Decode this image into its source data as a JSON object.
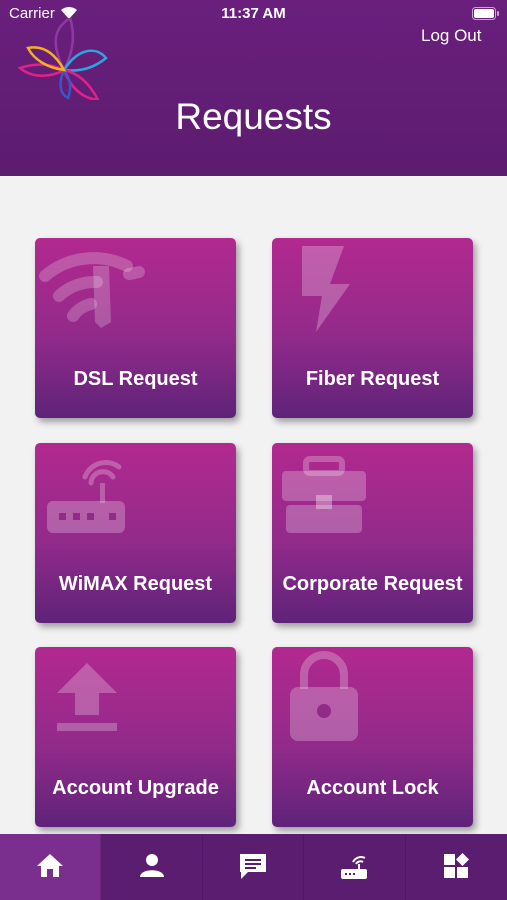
{
  "status_bar": {
    "carrier": "Carrier",
    "time": "11:37 AM"
  },
  "header": {
    "title": "Requests",
    "logout_label": "Log Out"
  },
  "tiles": [
    {
      "label": "DSL Request",
      "icon": "wifi-gauge-icon"
    },
    {
      "label": "Fiber Request",
      "icon": "lightning-bolt-icon"
    },
    {
      "label": "WiMAX Request",
      "icon": "router-icon"
    },
    {
      "label": "Corporate Request",
      "icon": "briefcase-icon"
    },
    {
      "label": "Account Upgrade",
      "icon": "upload-icon"
    },
    {
      "label": "Account Lock",
      "icon": "padlock-icon"
    }
  ],
  "tabbar": {
    "items": [
      {
        "icon": "home-icon",
        "active": true
      },
      {
        "icon": "person-icon",
        "active": false
      },
      {
        "icon": "message-icon",
        "active": false
      },
      {
        "icon": "router-icon",
        "active": false
      },
      {
        "icon": "apps-grid-icon",
        "active": false
      }
    ]
  },
  "colors": {
    "header": "#5c1c6f",
    "tile_top": "#b2298f",
    "tile_bottom": "#5e2379",
    "tabbar": "#5b1d6f",
    "background": "#f2f2f2"
  }
}
